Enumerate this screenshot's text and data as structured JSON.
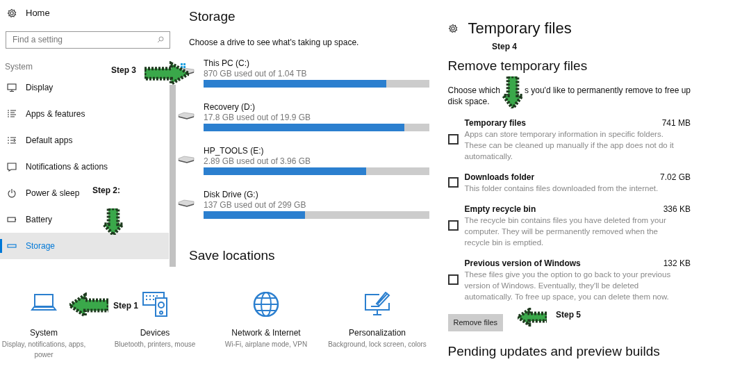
{
  "sidebar": {
    "home": "Home",
    "search": {
      "placeholder": "Find a setting"
    },
    "section": "System",
    "items": [
      {
        "label": "Display",
        "selected": false
      },
      {
        "label": "Apps & features",
        "selected": false
      },
      {
        "label": "Default apps",
        "selected": false
      },
      {
        "label": "Notifications & actions",
        "selected": false
      },
      {
        "label": "Power & sleep",
        "selected": false
      },
      {
        "label": "Battery",
        "selected": false
      },
      {
        "label": "Storage",
        "selected": true
      }
    ]
  },
  "storage": {
    "title": "Storage",
    "subtitle": "Choose a drive to see what's taking up space.",
    "drives": [
      {
        "name": "This PC (C:)",
        "usage": "870 GB used out of 1.04 TB",
        "level": 0.81
      },
      {
        "name": "Recovery (D:)",
        "usage": "17.8 GB used out of 19.9 GB",
        "level": 0.89
      },
      {
        "name": "HP_TOOLS (E:)",
        "usage": "2.89 GB used out of 3.96 GB",
        "level": 0.72
      },
      {
        "name": "Disk Drive (G:)",
        "usage": "137 GB used out of 299 GB",
        "level": 0.45
      }
    ],
    "save_locations": "Save locations"
  },
  "categories": [
    {
      "title": "System",
      "subtitle": "Display, notifications, apps, power"
    },
    {
      "title": "Devices",
      "subtitle": "Bluetooth, printers, mouse"
    },
    {
      "title": "Network & Internet",
      "subtitle": "Wi-Fi, airplane mode, VPN"
    },
    {
      "title": "Personalization",
      "subtitle": "Background, lock screen, colors"
    }
  ],
  "temporary_files": {
    "title": "Temporary files",
    "heading": "Remove temporary files",
    "intro_start": "Choose which",
    "intro_middle": "s you'd like to permanently remove to free up",
    "intro_end": "disk space.",
    "items": [
      {
        "name": "Temporary files",
        "size": "741 MB",
        "description": "Apps can store temporary information in specific folders. These can be cleaned up manually if the app does not do it automatically.",
        "checked": false
      },
      {
        "name": "Downloads folder",
        "size": "7.02 GB",
        "description": "This folder contains files downloaded from the internet.",
        "checked": false
      },
      {
        "name": "Empty recycle bin",
        "size": "336 KB",
        "description": "The recycle bin contains files you have deleted from your computer. They will be permanently removed when the recycle bin is emptied.",
        "checked": false
      },
      {
        "name": "Previous version of Windows",
        "size": "132 KB",
        "description": "These files give you the option to go back to your previous version of Windows. Eventually, they'll be deleted automatically. To free up space, you can delete them now.",
        "checked": false
      }
    ],
    "button": "Remove files",
    "next_heading": "Pending updates and preview builds"
  },
  "annotations": [
    {
      "label": "Step 1"
    },
    {
      "label": "Step 2:"
    },
    {
      "label": "Step 3"
    },
    {
      "label": "Step 4"
    },
    {
      "label": "Step 5"
    }
  ]
}
